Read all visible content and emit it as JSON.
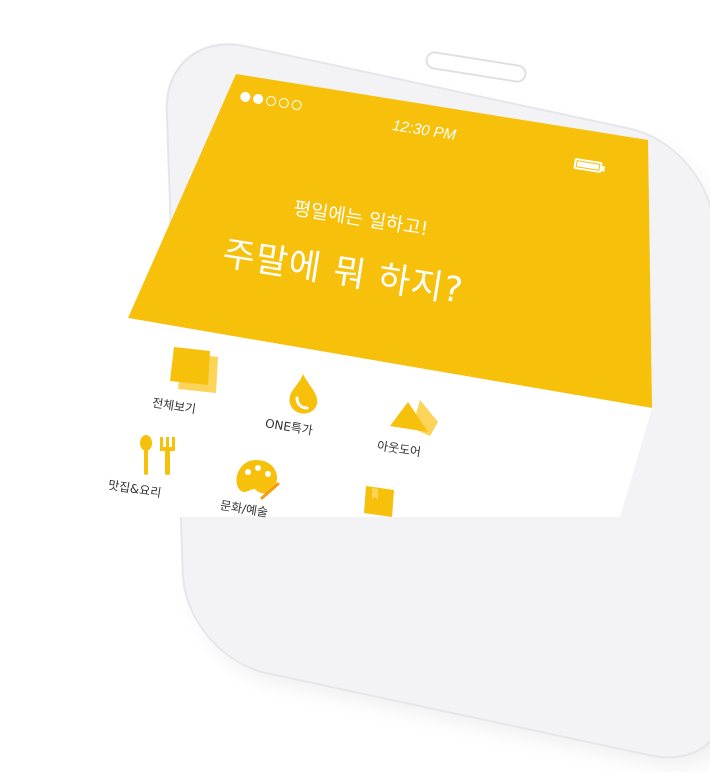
{
  "status_bar": {
    "time": "12:30 PM",
    "signal_dots": [
      true,
      true,
      false,
      false,
      false
    ]
  },
  "headline": {
    "subtitle": "평일에는 일하고!",
    "title": "주말에 뭐 하지?"
  },
  "menu": {
    "items": [
      {
        "label": "전체보기",
        "icon": "square-stack-icon"
      },
      {
        "label": "ONE특가",
        "icon": "drop-icon"
      },
      {
        "label": "아웃도어",
        "icon": "mountain-icon"
      },
      {
        "label": "맛집&요리",
        "icon": "fork-spoon-icon"
      },
      {
        "label": "문화/예술",
        "icon": "palette-icon"
      },
      {
        "label": "",
        "icon": "book-icon"
      }
    ]
  },
  "colors": {
    "accent": "#f7c00b",
    "accent_light": "#fcd45a",
    "phone_body": "#f3f3f5"
  }
}
